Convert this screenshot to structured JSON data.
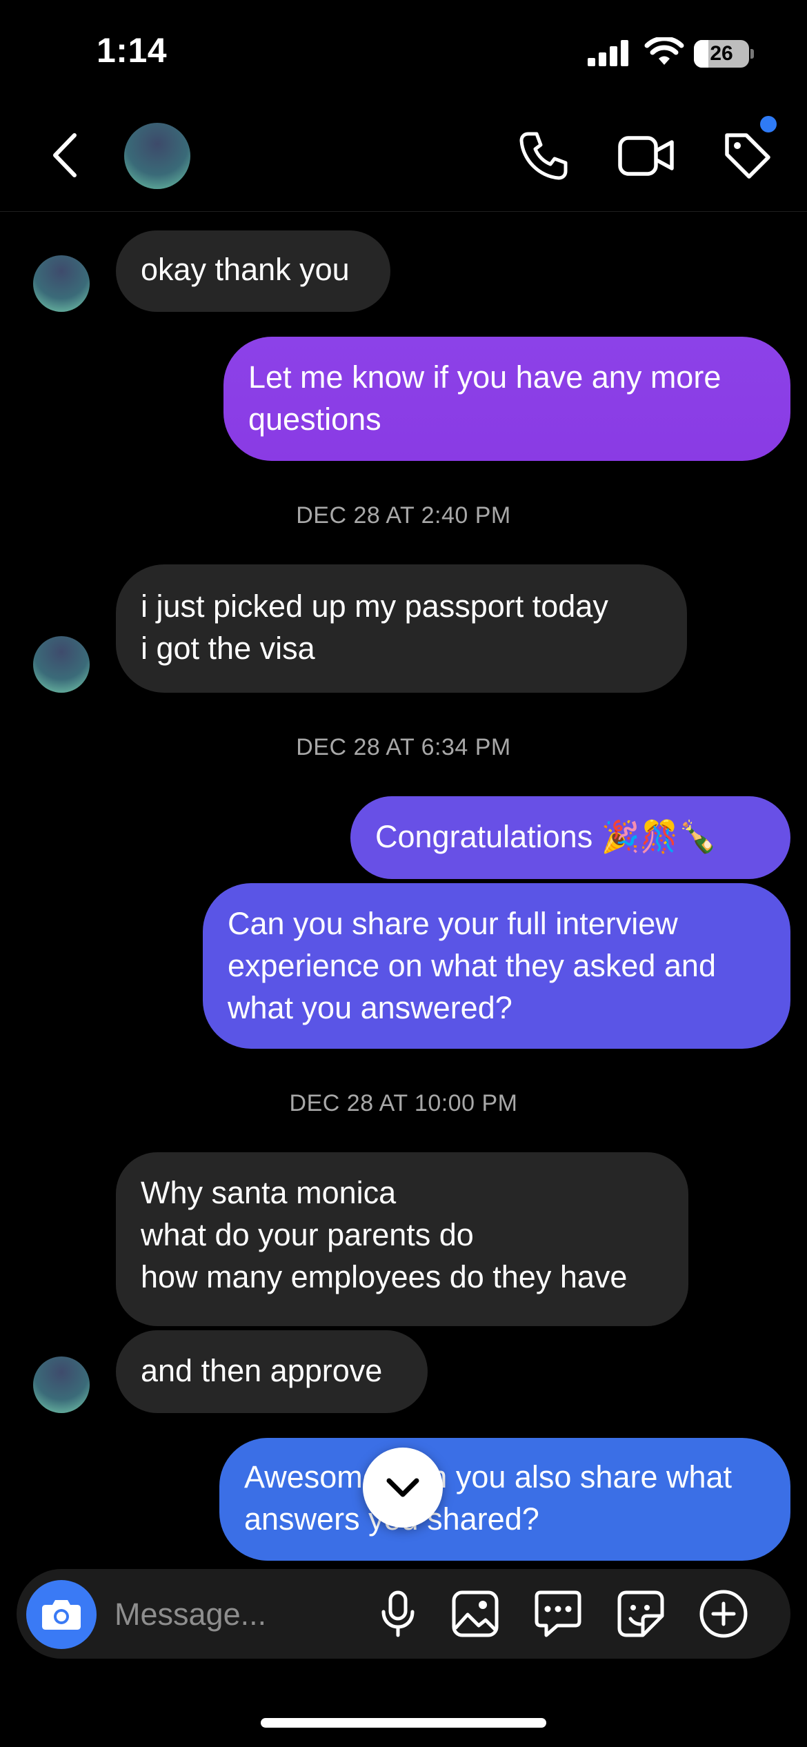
{
  "status_bar": {
    "time": "1:14",
    "battery": "26",
    "battery_level_percent": 26
  },
  "header": {
    "icons": [
      "back-icon",
      "phone-icon",
      "video-icon",
      "tag-icon"
    ]
  },
  "messages": [
    {
      "side": "in",
      "text": "okay thank you"
    },
    {
      "side": "out",
      "text": "Let me know if you have any more questions"
    },
    {
      "type": "timestamp",
      "text": "DEC 28 AT 2:40 PM"
    },
    {
      "side": "in",
      "text": "i just picked up my passport today\ni got the visa"
    },
    {
      "type": "timestamp",
      "text": "DEC 28 AT 6:34 PM"
    },
    {
      "side": "out",
      "text": "Congratulations 🎉🎊🍾"
    },
    {
      "side": "out",
      "text": "Can you share your full interview experience on what they asked and what you answered?"
    },
    {
      "type": "timestamp",
      "text": "DEC 28 AT 10:00 PM"
    },
    {
      "side": "in",
      "text": "Why santa monica\nwhat do your parents do\nhow many employees do they have"
    },
    {
      "side": "in",
      "text": "and then approve"
    },
    {
      "side": "out",
      "text": "Awesome, can you also share what answers you shared?"
    }
  ],
  "composer": {
    "placeholder": "Message...",
    "icons": [
      "camera-icon",
      "microphone-icon",
      "gallery-icon",
      "chat-bubble-icon",
      "sticker-icon",
      "plus-icon"
    ]
  },
  "colors": {
    "background": "#000000",
    "incoming_bubble": "#262626",
    "outgoing_purple": "#8a3ee6",
    "outgoing_indigo": "#5a55e6",
    "outgoing_blue": "#3b6fe6",
    "camera_button": "#3a7af5",
    "notification_dot": "#2f7bf6"
  }
}
